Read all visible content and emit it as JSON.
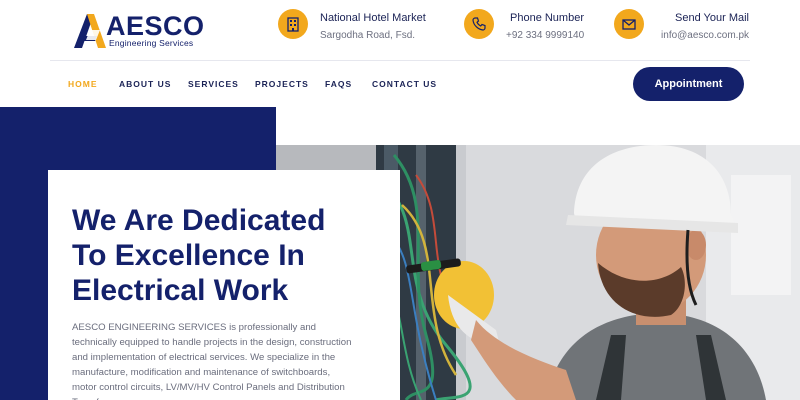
{
  "logo": {
    "name": "AESCO",
    "tagline": "Engineering Services"
  },
  "contact": {
    "market": {
      "title": "National Hotel Market",
      "subtitle": "Sargodha Road, Fsd.",
      "icon": "building-icon"
    },
    "phone": {
      "title": "Phone Number",
      "subtitle": "+92 334 9999140",
      "icon": "phone-icon"
    },
    "mail": {
      "title": "Send Your Mail",
      "subtitle": "info@aesco.com.pk",
      "icon": "mail-icon"
    }
  },
  "nav": {
    "items": [
      {
        "label": "HOME",
        "active": true
      },
      {
        "label": "ABOUT US"
      },
      {
        "label": "SERVICES"
      },
      {
        "label": "PROJECTS"
      },
      {
        "label": "FAQS"
      },
      {
        "label": "CONTACT US"
      }
    ],
    "appointment_label": "Appointment"
  },
  "hero": {
    "title_line1": "We Are Dedicated",
    "title_line2": "To Excellence In",
    "title_line3": "Electrical Work",
    "description": "AESCO ENGINEERING SERVICES is professionally and technically equipped to handle projects in the design, construction and implementation of electrical services. We specialize in the manufacture, modification and maintenance of switchboards, motor control circuits, LV/MV/HV Control Panels and Distribution Transformers."
  },
  "colors": {
    "brand_navy": "#14216b",
    "accent_orange": "#f2a81d"
  }
}
